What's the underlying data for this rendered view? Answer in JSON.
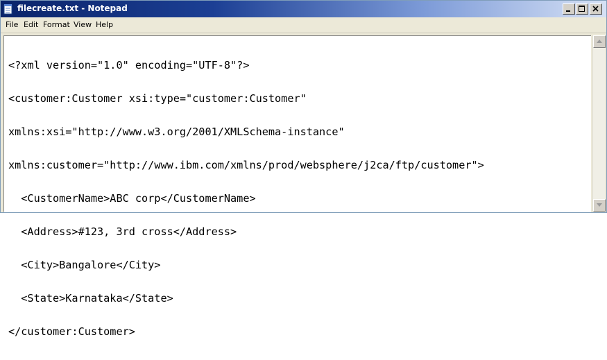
{
  "window": {
    "title": "filecreate.txt - Notepad",
    "buttons": [
      "minimize",
      "maximize",
      "close"
    ]
  },
  "menu": {
    "items": [
      "File",
      "Edit",
      "Format",
      "View",
      "Help"
    ]
  },
  "editor": {
    "lines": [
      "<?xml version=\"1.0\" encoding=\"UTF-8\"?>",
      "<customer:Customer xsi:type=\"customer:Customer\"",
      "xmlns:xsi=\"http://www.w3.org/2001/XMLSchema-instance\"",
      "xmlns:customer=\"http://www.ibm.com/xmlns/prod/websphere/j2ca/ftp/customer\">",
      "  <CustomerName>ABC corp</CustomerName>",
      "  <Address>#123, 3rd cross</Address>",
      "  <City>Bangalore</City>",
      "  <State>Karnataka</State>",
      "</customer:Customer>"
    ]
  },
  "colors": {
    "titlebar_start": "#0a246a",
    "titlebar_end": "#d6e1f5",
    "chrome": "#ece9d8"
  },
  "icons": {
    "app": "notepad-icon",
    "minimize": "minimize-icon",
    "maximize": "maximize-icon",
    "close": "close-icon",
    "scroll_up": "arrow-up-icon",
    "scroll_down": "arrow-down-icon"
  }
}
